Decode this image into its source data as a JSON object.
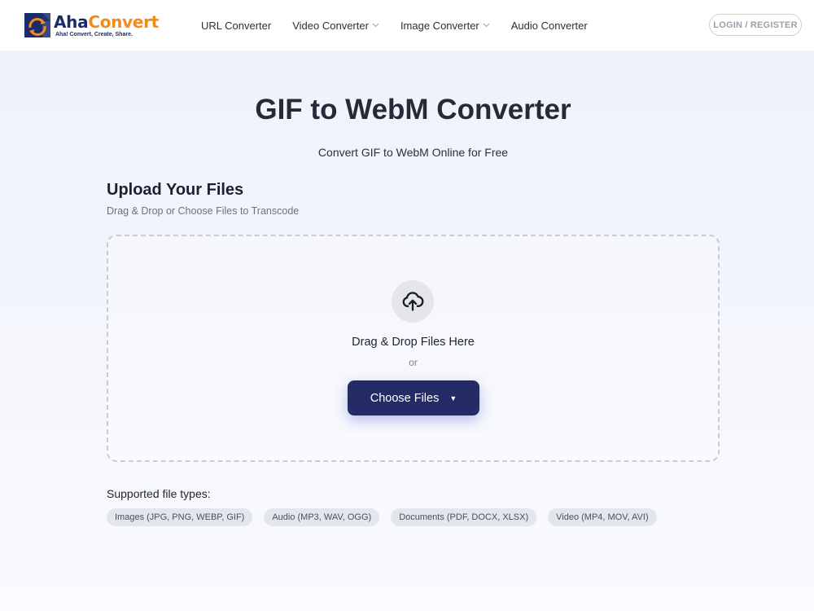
{
  "header": {
    "logo": {
      "name_part1": "Aha",
      "name_part2": "Convert",
      "tagline": "Aha! Convert, Create, Share."
    },
    "nav": [
      {
        "label": "URL Converter",
        "dropdown": false
      },
      {
        "label": "Video Converter",
        "dropdown": true
      },
      {
        "label": "Image Converter",
        "dropdown": true
      },
      {
        "label": "Audio Converter",
        "dropdown": false
      }
    ],
    "login_label": "LOGIN / REGISTER"
  },
  "hero": {
    "title": "GIF to WebM Converter",
    "subtitle": "Convert GIF to WebM Online for Free"
  },
  "upload": {
    "heading": "Upload Your Files",
    "subheading": "Drag & Drop or Choose Files to Transcode",
    "drop_text": "Drag & Drop Files Here",
    "or_text": "or",
    "choose_label": "Choose Files",
    "choose_caret": "▼"
  },
  "supported": {
    "label": "Supported file types:",
    "types": [
      "Images (JPG, PNG, WEBP, GIF)",
      "Audio (MP3, WAV, OGG)",
      "Documents (PDF, DOCX, XLSX)",
      "Video (MP4, MOV, AVI)"
    ]
  },
  "icons": {
    "upload": "cloud-upload-icon",
    "chevron": "chevron-down-icon"
  },
  "colors": {
    "brand_navy": "#1b2a6b",
    "brand_orange": "#f28a1c",
    "button": "#252b66"
  }
}
